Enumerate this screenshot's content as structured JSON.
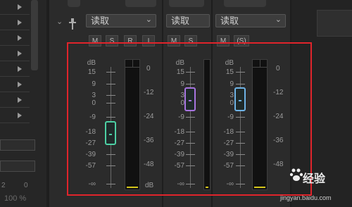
{
  "left_panel": {
    "footer_numbers": [
      "2",
      "0"
    ],
    "zoom_label": "100 %"
  },
  "channels": [
    {
      "input_select": "读取",
      "buttons": [
        "M",
        "S",
        "R",
        "I"
      ],
      "fader_color": "#4dd0a4",
      "left_scale": [
        "dB",
        "15",
        "9",
        "3",
        "0",
        "-9",
        "-18",
        "-27",
        "-39",
        "-57",
        "-∞"
      ],
      "right_scale": [
        "0",
        "-12",
        "-24",
        "-36",
        "-48",
        "dB"
      ]
    },
    {
      "input_select": "读取",
      "buttons": [
        "M",
        "S"
      ],
      "fader_color": "#a774e0",
      "left_scale": [
        "dB",
        "15",
        "9",
        "3",
        "0",
        "-9",
        "-18",
        "-27",
        "-39",
        "-57",
        "-∞"
      ]
    },
    {
      "input_select": "读取",
      "buttons": [
        "M",
        "(S)"
      ],
      "fader_color": "#6fb3e6",
      "left_scale": [
        "dB",
        "15",
        "9",
        "3",
        "0",
        "-9",
        "-18",
        "-27",
        "-39",
        "-57",
        "-∞"
      ],
      "right_scale": [
        "0",
        "-12",
        "-24",
        "-36",
        "-48",
        "dB"
      ]
    }
  ],
  "colors": {
    "highlight_box": "#e0242b",
    "meter_level": "#d4c51a"
  },
  "watermark": {
    "brand": "经验",
    "url": "jingyan.baidu.com"
  }
}
